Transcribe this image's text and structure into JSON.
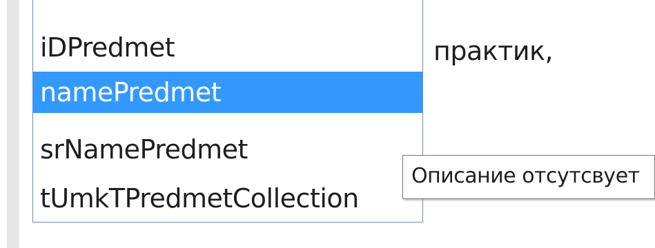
{
  "editor": {
    "visible_text": "практик,"
  },
  "completion_list": {
    "items": [
      {
        "label": "iDPredmet",
        "selected": false
      },
      {
        "label": "namePredmet",
        "selected": true
      },
      {
        "label": "srNamePredmet",
        "selected": false
      },
      {
        "label": "tUmkTPredmetCollection",
        "selected": false
      }
    ],
    "selection_color": "#3399ff"
  },
  "tooltip": {
    "text": "Описание отсутсвует"
  }
}
